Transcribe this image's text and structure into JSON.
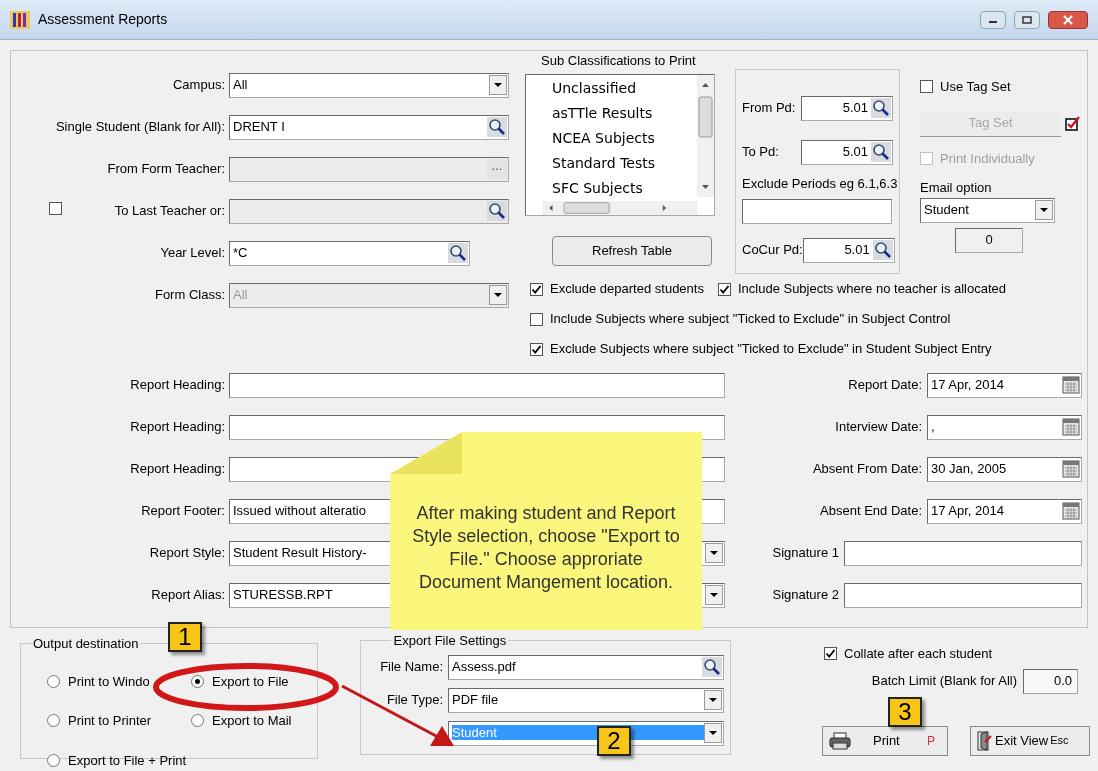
{
  "window": {
    "title": "Assessment Reports"
  },
  "selection_fields": [
    {
      "kind": "dropdown",
      "label": "Campus:",
      "value": "All",
      "disabled": false
    },
    {
      "kind": "lookup",
      "label": "Single Student (Blank for All):",
      "value": "DRENT I",
      "disabled": false
    },
    {
      "kind": "browse",
      "label": "From Form Teacher:",
      "button": "...",
      "disabled": true
    },
    {
      "kind": "lookup",
      "label": "To Last Teacher or:",
      "disabled": true,
      "checkbox": {
        "checked": false
      }
    },
    {
      "kind": "lookup_short",
      "label": "Year Level:",
      "value": "*C",
      "disabled": false
    },
    {
      "kind": "dropdown",
      "label": "Form Class:",
      "value": "All",
      "disabled": true
    }
  ],
  "sub_classifications": {
    "title": "Sub Classifications to Print",
    "items": [
      "Unclassified",
      "asTTle Results",
      "NCEA Subjects",
      "Standard Tests",
      "SFC Subjects"
    ],
    "button": "Refresh Table"
  },
  "periods": [
    {
      "kind": "lookup",
      "label": "From Pd:",
      "value": "5.01"
    },
    {
      "kind": "lookup",
      "label": "To Pd:",
      "value": "5.01"
    },
    {
      "kind": "text",
      "label": "Exclude Periods eg 6.1,6.3"
    },
    {
      "kind": "lookup",
      "label": "CoCur Pd:",
      "value": "5.01"
    }
  ],
  "tag_options": {
    "use_tag_set": {
      "label": "Use Tag Set",
      "checked": false
    },
    "tag_set_button": {
      "label": "Tag Set",
      "disabled": true
    },
    "print_individually": {
      "label": "Print Individually",
      "checked": false,
      "disabled": true
    },
    "email_option": {
      "label": "Email option",
      "value": "Student"
    },
    "count": "0"
  },
  "option_lines": [
    {
      "options": [
        {
          "label": "Exclude departed students",
          "checked": true
        },
        {
          "label": "Include Subjects where no teacher is allocated",
          "checked": true
        }
      ]
    },
    {
      "options": [
        {
          "label": "Include Subjects where subject \"Ticked to Exclude\" in Subject Control",
          "checked": false
        }
      ]
    },
    {
      "options": [
        {
          "label": "Exclude Subjects where subject \"Ticked to Exclude\" in Student Subject Entry",
          "checked": true
        }
      ]
    }
  ],
  "report_rows": [
    {
      "left": {
        "kind": "text",
        "label": "Report Heading:"
      },
      "right": {
        "kind": "date",
        "label": "Report Date:",
        "value": "17 Apr, 2014"
      }
    },
    {
      "left": {
        "kind": "text",
        "label": "Report Heading:"
      },
      "right": {
        "kind": "date",
        "label": "Interview Date:",
        "value": ","
      }
    },
    {
      "left": {
        "kind": "text",
        "label": "Report Heading:"
      },
      "right": {
        "kind": "date",
        "label": "Absent From Date:",
        "value": "30 Jan, 2005"
      }
    },
    {
      "left": {
        "kind": "text",
        "label": "Report Footer:",
        "value": "Issued without alteratio"
      },
      "right": {
        "kind": "date",
        "label": "Absent End Date:",
        "value": "17 Apr, 2014"
      }
    },
    {
      "left": {
        "kind": "dropdown",
        "label": "Report Style:",
        "value": "Student Result History-"
      },
      "right": {
        "kind": "text",
        "label": "Signature 1"
      }
    },
    {
      "left": {
        "kind": "dropdown",
        "label": "Report Alias:",
        "value": "STURESSB.RPT"
      },
      "right": {
        "kind": "text",
        "label": "Signature 2"
      }
    }
  ],
  "output_destination": {
    "title": "Output destination",
    "options": [
      {
        "label": "Print to Windo",
        "selected": false
      },
      {
        "label": "Export to File",
        "selected": true
      },
      {
        "label": "Print to Printer",
        "selected": false
      },
      {
        "label": "Export to Mail",
        "selected": false
      },
      {
        "label": "Export to File + Print",
        "selected": false
      }
    ]
  },
  "export_file_settings": {
    "title": "Export  File Settings",
    "fields": [
      {
        "kind": "lookup",
        "label": "File Name:",
        "value": "Assess.pdf"
      },
      {
        "kind": "dropdown",
        "label": "File Type:",
        "value": "PDF file"
      },
      {
        "kind": "dropdown_focused",
        "value": "Student"
      }
    ]
  },
  "collate": {
    "label": "Collate after each student",
    "checked": true
  },
  "batch_limit": {
    "label": "Batch Limit (Blank for All)",
    "value": "0.0"
  },
  "buttons": [
    {
      "kind": "print",
      "label": "Print",
      "shortcut": "P"
    },
    {
      "kind": "exit",
      "label": "Exit View",
      "shortcut": "Esc"
    }
  ],
  "annotations": {
    "callout": "After making student and Report Style selection, choose \"Export to File.\" Choose approriate Document Mangement location.",
    "steps": [
      "1",
      "2",
      "3"
    ]
  }
}
